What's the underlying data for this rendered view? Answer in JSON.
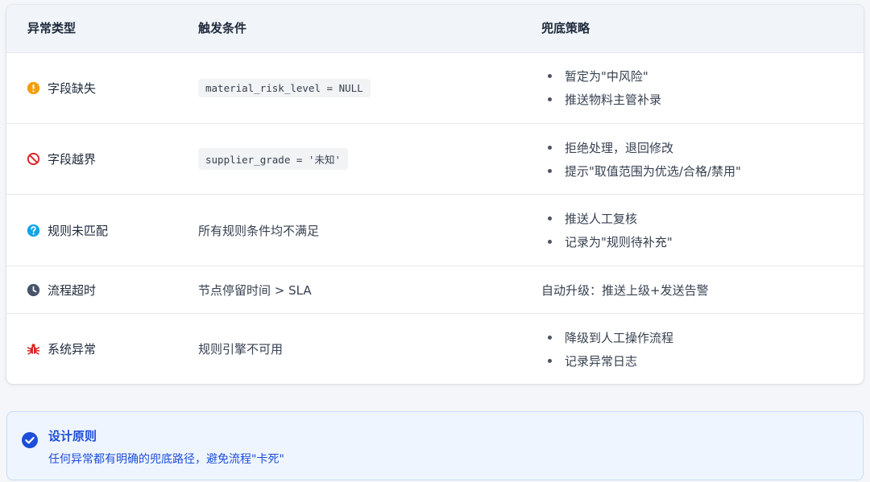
{
  "table": {
    "headers": {
      "type": "异常类型",
      "condition": "触发条件",
      "strategy": "兜底策略"
    },
    "rows": [
      {
        "icon": "warning-circle-icon",
        "icon_color": "#f59e0b",
        "type": "字段缺失",
        "condition_code": "material_risk_level = NULL",
        "strategies": [
          "暂定为\"中风险\"",
          "推送物料主管补录"
        ]
      },
      {
        "icon": "prohibited-icon",
        "icon_color": "#dc2626",
        "type": "字段越界",
        "condition_code": "supplier_grade = '未知'",
        "strategies": [
          "拒绝处理，退回修改",
          "提示\"取值范围为优选/合格/禁用\""
        ]
      },
      {
        "icon": "question-circle-icon",
        "icon_color": "#0ea5e9",
        "type": "规则未匹配",
        "condition_text": "所有规则条件均不满足",
        "strategies": [
          "推送人工复核",
          "记录为\"规则待补充\""
        ]
      },
      {
        "icon": "clock-icon",
        "icon_color": "#475569",
        "type": "流程超时",
        "condition_text": "节点停留时间 > SLA",
        "strategy_text": "自动升级：推送上级+发送告警"
      },
      {
        "icon": "bug-icon",
        "icon_color": "#dc2626",
        "type": "系统异常",
        "condition_text": "规则引擎不可用",
        "strategies": [
          "降级到人工操作流程",
          "记录异常日志"
        ]
      }
    ]
  },
  "principle": {
    "icon": "check-circle-icon",
    "icon_color": "#1d4ed8",
    "title": "设计原则",
    "description": "任何异常都有明确的兜底路径，避免流程\"卡死\""
  }
}
